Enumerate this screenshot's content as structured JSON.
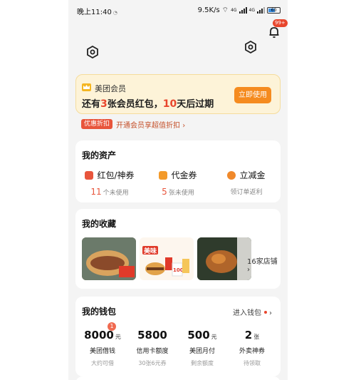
{
  "status_bar": {
    "time": "晚上11:40",
    "net_speed": "9.5K/s",
    "net1": "4G",
    "net2": "4G",
    "battery": "60"
  },
  "header": {
    "notification_badge": "99+"
  },
  "vip_card": {
    "title": "美团会员",
    "msg_pre": "还有",
    "count": "3",
    "msg_mid": "张会员红包，",
    "days": "10",
    "msg_post": "天后过期",
    "button": "立即使用"
  },
  "promo": {
    "tag": "优惠折扣",
    "text": "开通会员享超值折扣 ›"
  },
  "assets": {
    "title": "我的资产",
    "items": [
      {
        "label": "红包/神券",
        "count": "11",
        "sub": "个未使用",
        "color": "#e8553c"
      },
      {
        "label": "代金券",
        "count": "5",
        "sub": "张未使用",
        "color": "#f39a2a"
      },
      {
        "label": "立减金",
        "count": "",
        "sub": "领订单返利",
        "color": "#f0892b"
      }
    ]
  },
  "favorites": {
    "title": "我的收藏",
    "more": "16家店铺",
    "thumb_texts": [
      "美味",
      "100"
    ]
  },
  "wallet": {
    "title": "我的钱包",
    "enter": "进入钱包",
    "badge": "1",
    "items": [
      {
        "value": "8000",
        "unit": "元",
        "label": "美团借钱",
        "sub": "大约可借"
      },
      {
        "value": "5800",
        "unit": "",
        "label": "信用卡额度",
        "sub": "30张6元券"
      },
      {
        "value": "500",
        "unit": "元",
        "label": "美团月付",
        "sub": "剩余额度"
      },
      {
        "value": "2",
        "unit": "张",
        "label": "外卖神券",
        "sub": "待领取"
      }
    ]
  }
}
